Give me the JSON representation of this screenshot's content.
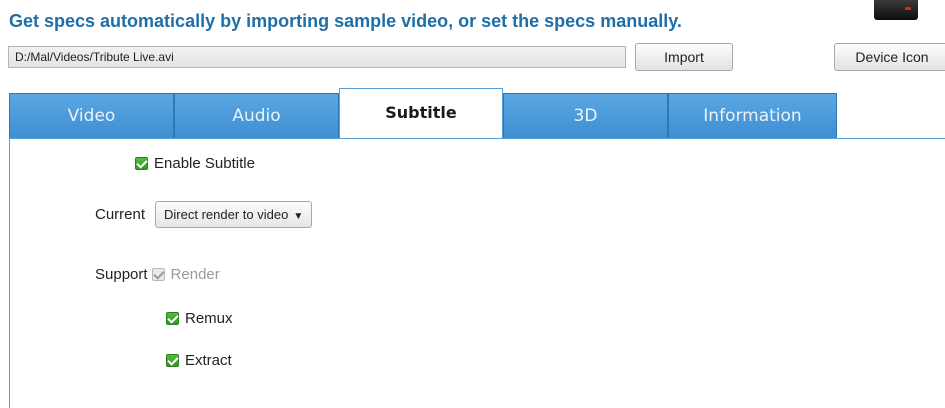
{
  "header": {
    "title": "Get specs automatically by importing sample video, or set the specs manually."
  },
  "import": {
    "path_value": "D:/Mal/Videos/Tribute Live.avi",
    "import_label": "Import",
    "device_icon_label": "Device Icon"
  },
  "tabs": [
    {
      "label": "Video"
    },
    {
      "label": "Audio"
    },
    {
      "label": "Subtitle"
    },
    {
      "label": "3D"
    },
    {
      "label": "Information"
    }
  ],
  "active_tab": "Subtitle",
  "subtitle": {
    "enable_label": "Enable Subtitle",
    "enable_checked": true,
    "current_label": "Current",
    "current_value": "Direct render to video",
    "support_label": "Support",
    "options": [
      {
        "label": "Render",
        "checked": true,
        "disabled": true
      },
      {
        "label": "Remux",
        "checked": true,
        "disabled": false
      },
      {
        "label": "Extract",
        "checked": true,
        "disabled": false
      }
    ]
  },
  "colors": {
    "title_blue": "#1e6fa8",
    "tab_blue": "#4a9ad9",
    "check_green": "#3aaa2c"
  }
}
